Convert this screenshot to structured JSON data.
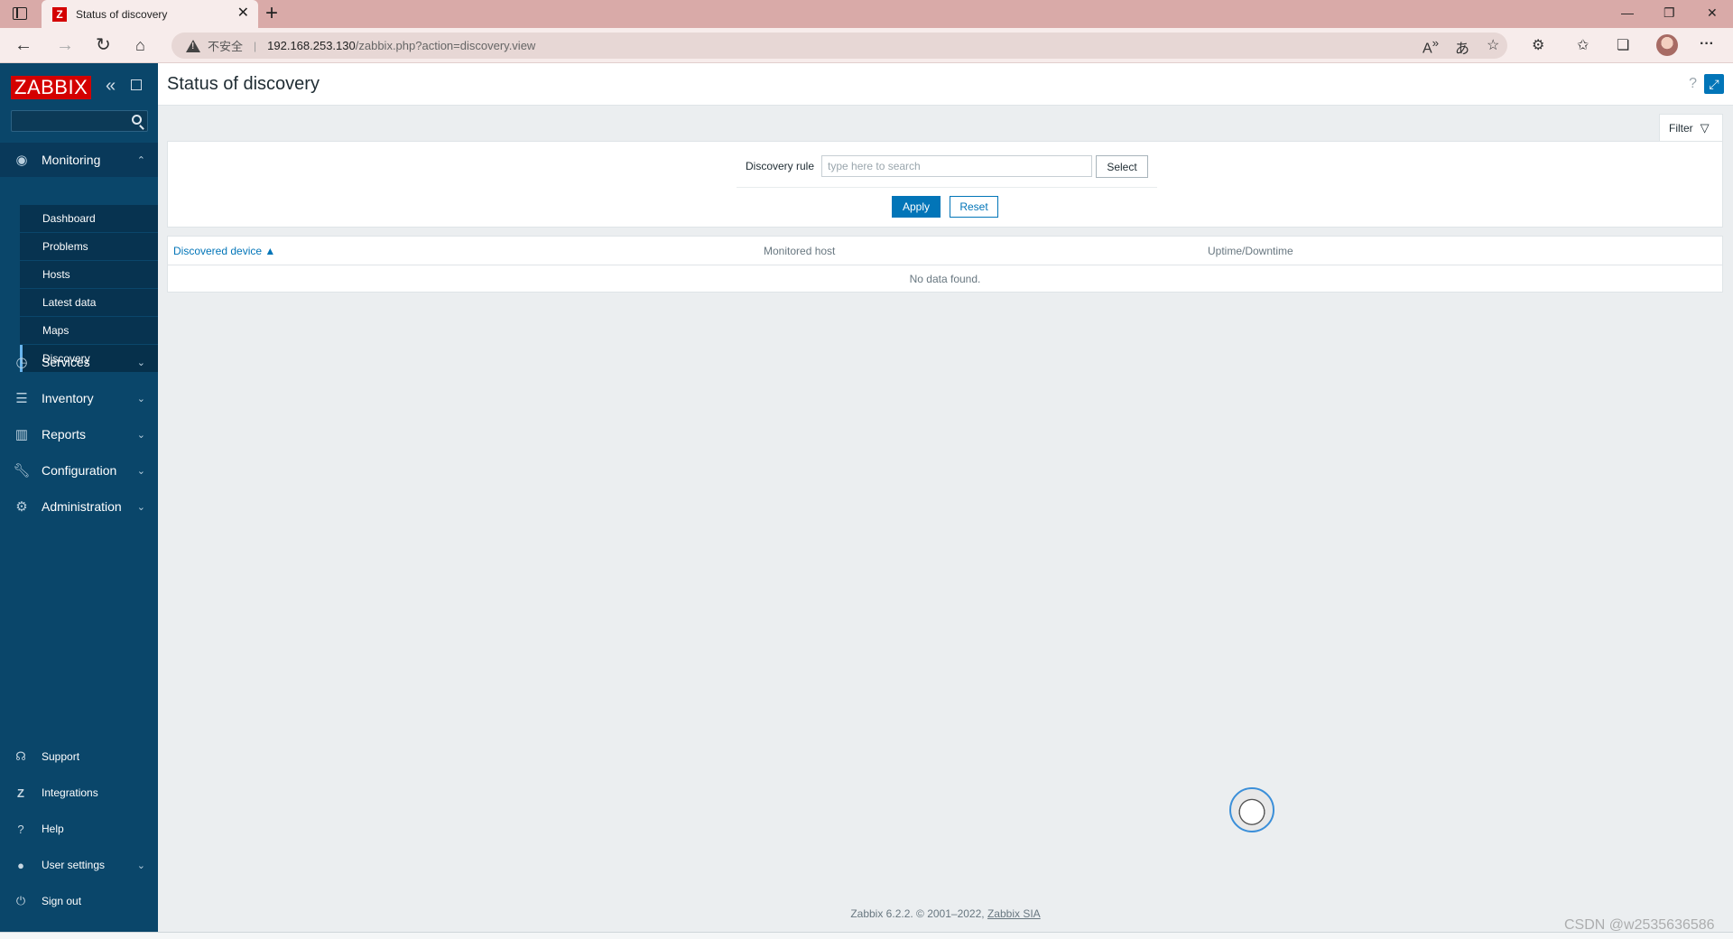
{
  "browser": {
    "tab_title": "Status of discovery",
    "tab_favicon": "Z",
    "new_tab_symbol": "+",
    "security_label": "不安全",
    "url_host": "192.168.253.130",
    "url_path": "/zabbix.php?action=discovery.view"
  },
  "sidebar": {
    "logo": "ZABBIX",
    "search_placeholder": "",
    "monitoring": {
      "label": "Monitoring",
      "items": [
        "Dashboard",
        "Problems",
        "Hosts",
        "Latest data",
        "Maps",
        "Discovery"
      ],
      "selected": "Discovery"
    },
    "menu": [
      {
        "label": "Services",
        "icon": "services-icon"
      },
      {
        "label": "Inventory",
        "icon": "inventory-icon"
      },
      {
        "label": "Reports",
        "icon": "reports-icon"
      },
      {
        "label": "Configuration",
        "icon": "wrench-icon"
      },
      {
        "label": "Administration",
        "icon": "administration-icon"
      }
    ],
    "bottom": {
      "support": "Support",
      "integrations": "Integrations",
      "help": "Help",
      "user_settings": "User settings",
      "sign_out": "Sign out"
    }
  },
  "page": {
    "title": "Status of discovery"
  },
  "filter": {
    "tab_label": "Filter",
    "discovery_rule_label": "Discovery rule",
    "discovery_rule_placeholder": "type here to search",
    "select_label": "Select",
    "apply_label": "Apply",
    "reset_label": "Reset"
  },
  "table": {
    "columns": [
      "Discovered device ▲",
      "Monitored host",
      "Uptime/Downtime"
    ],
    "empty_message": "No data found."
  },
  "footer": {
    "text": "Zabbix 6.2.2. © 2001–2022,",
    "link": "Zabbix SIA"
  },
  "watermark": "CSDN @w2535636586",
  "colors": {
    "sidebar": "#0a466a",
    "accent": "#0275b8",
    "logo": "#d40000"
  }
}
